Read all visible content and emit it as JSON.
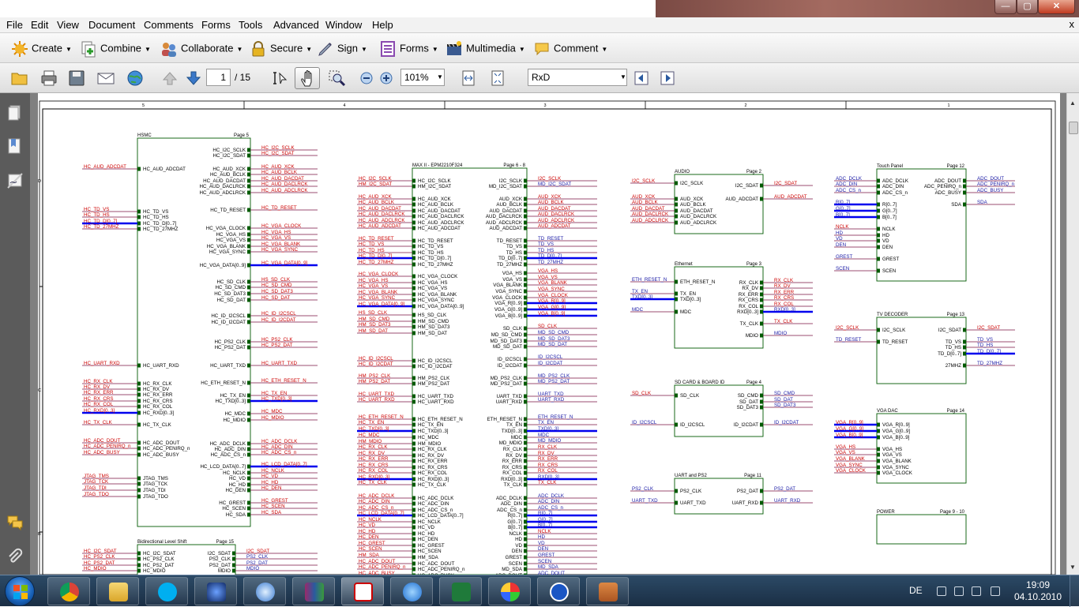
{
  "menu": {
    "items": [
      "File",
      "Edit",
      "View",
      "Document",
      "Comments",
      "Forms",
      "Tools",
      "Advanced",
      "Window",
      "Help"
    ],
    "close_glyph": "x"
  },
  "toolbar": {
    "tasks": [
      {
        "label": "Create",
        "icon": "create-icon"
      },
      {
        "label": "Combine",
        "icon": "combine-icon"
      },
      {
        "label": "Collaborate",
        "icon": "collaborate-icon"
      },
      {
        "label": "Secure",
        "icon": "lock-icon"
      },
      {
        "label": "Sign",
        "icon": "pen-icon"
      },
      {
        "label": "Forms",
        "icon": "forms-icon"
      },
      {
        "label": "Multimedia",
        "icon": "multimedia-icon"
      },
      {
        "label": "Comment",
        "icon": "comment-icon"
      }
    ]
  },
  "nav": {
    "page_current": "1",
    "page_total": "/ 15",
    "zoom": "101%",
    "find": "RxD"
  },
  "schematic": {
    "grid_top": [
      "5",
      "4",
      "3",
      "2",
      "1"
    ],
    "grid_left": [
      "D",
      "C",
      "B"
    ],
    "blocks": [
      {
        "id": "hsmc",
        "title": "HSMC",
        "page": "Page 5",
        "left_pins": [
          "HC_AUD_ADCDAT",
          "HC_TD_VS",
          "HC_TD_HS",
          "HC_TD_D[0..7]",
          "HC_TD_27MHZ",
          "HC_UART_RXD",
          "HC_RX_CLK",
          "HC_RX_DV",
          "HC_RX_ERR",
          "HC_RX_CRS",
          "HC_RX_COL",
          "HC_RXD[0..3]",
          "HC_TX_CLK",
          "HC_ADC_DOUT",
          "HC_ADC_PENIRQ_n",
          "HC_ADC_BUSY",
          "JTAG_TMS",
          "JTAG_TCK",
          "JTAG_TDI",
          "JTAG_TDO"
        ],
        "left_nets": [
          "HC_AUD_ADCDAT",
          "HC_TD_VS",
          "HC_TD_HS",
          "HC_TD_D[0..7]",
          "HC_TD_27MHZ",
          "HC_UART_RXD",
          "HC_RX_CLK",
          "HC_RX_DV",
          "HC_RX_ERR",
          "HC_RX_CRS",
          "HC_RX_COL",
          "HC_RXD[0..3]",
          "HC_TX_CLK",
          "HC_ADC_DOUT",
          "HC_ADC_PENIRQ_n",
          "HC_ADC_BUSY",
          "JTAG_TMS",
          "JTAG_TCK",
          "JTAG_TDI",
          "JTAG_TDO"
        ],
        "right_pins": [
          "HC_I2C_SCLK",
          "HC_I2C_SDAT",
          "HC_AUD_XCK",
          "HC_AUD_BCLK",
          "HC_AUD_DACDAT",
          "HC_AUD_DACLRCK",
          "HC_AUD_ADCLRCK",
          "HC_TD_RESET",
          "HC_VGA_CLOCK",
          "HC_VGA_HS",
          "HC_VGA_VS",
          "HC_VGA_BLANK",
          "HC_VGA_SYNC",
          "HC_VGA_DATA[0..9]",
          "HC_SD_CLK",
          "HC_SD_CMD",
          "HC_SD_DAT3",
          "HC_SD_DAT",
          "HC_ID_I2CSCL",
          "HC_ID_I2CDAT",
          "HC_PS2_CLK",
          "HC_PS2_DAT",
          "HC_UART_TXD",
          "HC_ETH_RESET_N",
          "HC_TX_EN",
          "HC_TXD[0..3]",
          "HC_MDC",
          "HC_MDIO",
          "HC_ADC_DCLK",
          "HC_ADC_DIN",
          "HC_ADC_CS_n",
          "HC_LCD_DATA[0..7]",
          "HC_NCLK",
          "HC_VD",
          "HC_HD",
          "HC_DEN",
          "HC_GREST",
          "HC_SCEN",
          "HC_SDA"
        ],
        "right_nets": [
          "HC_I2C_SCLK",
          "HC_I2C_SDAT",
          "HC_AUD_XCK",
          "HC_AUD_BCLK",
          "HC_AUD_DACDAT",
          "HC_AUD_DACLRCK",
          "HC_AUD_ADCLRCK",
          "HC_TD_RESET",
          "HC_VGA_CLOCK",
          "HC_VGA_HS",
          "HC_VGA_VS",
          "HC_VGA_BLANK",
          "HC_VGA_SYNC",
          "HC_VGA_DATA[0..9]",
          "HS_SD_CLK",
          "HC_SD_CMD",
          "HC_SD_DAT3",
          "HC_SD_DAT",
          "HC_ID_I2CSCL",
          "HC_ID_I2CDAT",
          "HC_PS2_CLK",
          "HC_PS2_DAT",
          "HC_UART_TXD",
          "HC_ETH_RESET_N",
          "HC_TX_EN",
          "HC_TXD[0..3]",
          "HC_MDC",
          "HC_MDIO",
          "HC_ADC_DCLK",
          "HC_ADC_DIN",
          "HC_ADC_CS_n",
          "HC_LCD_DATA[0..7]",
          "HC_NCLK",
          "HC_VD",
          "HC_HD",
          "HC_DEN",
          "HC_GREST",
          "HC_SCEN",
          "HC_SDA"
        ]
      },
      {
        "id": "maxii",
        "title": "MAX II - EPM2210F324",
        "page": "Page 6 - 8",
        "left_pins": [
          "HC_I2C_SCLK",
          "HM_I2C_SDAT",
          "HC_AUD_XCK",
          "HC_AUD_BCLK",
          "HC_AUD_DACDAT",
          "HC_AUD_DACLRCK",
          "HC_AUD_ADCLRCK",
          "HC_AUD_ADCDAT",
          "HC_TD_RESET",
          "HC_TD_VS",
          "HC_TD_HS",
          "HC_TD_D[0..7]",
          "HC_TD_27MHZ",
          "HC_VGA_CLOCK",
          "HC_VGA_HS",
          "HC_VGA_VS",
          "HC_VGA_BLANK",
          "HC_VGA_SYNC",
          "HC_VGA_DATA[0..9]",
          "HS_SD_CLK",
          "HM_SD_CMD",
          "HM_SD_DAT3",
          "HM_SD_DAT",
          "HC_ID_I2CSCL",
          "HC_ID_I2CDAT",
          "HM_PS2_CLK",
          "HM_PS2_DAT",
          "HC_UART_TXD",
          "HC_UART_RXD",
          "HC_ETH_RESET_N",
          "HC_TX_EN",
          "HC_TXD[0..3]",
          "HC_MDC",
          "HM_MDIO",
          "HC_RX_CLK",
          "HC_RX_DV",
          "HC_RX_ERR",
          "HC_RX_CRS",
          "HC_RX_COL",
          "HC_RXD[0..3]",
          "HC_TX_CLK",
          "HC_ADC_DCLK",
          "HC_ADC_DIN",
          "HC_ADC_CS_n",
          "HC_LCD_DATA[0..7]",
          "HC_NCLK",
          "HC_VD",
          "HC_HD",
          "HC_DEN",
          "HC_GREST",
          "HC_SCEN",
          "HM_SDA",
          "HC_ADC_DOUT",
          "HC_ADC_PENIRQ_n",
          "HC_ADC_BUSY"
        ],
        "left_nets": [
          "HC_I2C_SCLK",
          "HM_I2C_SDAT",
          "HC_AUD_XCK",
          "HC_AUD_BCLK",
          "HC_AUD_DACDAT",
          "HC_AUD_DACLRCK",
          "HC_AUD_ADCLRCK",
          "HC_AUD_ADCDAT",
          "HC_TD_RESET",
          "HC_TD_VS",
          "HC_TD_HS",
          "HC_TD_D[0..7]",
          "HC_TD_27MHZ",
          "HC_VGA_CLOCK",
          "HC_VGA_HS",
          "HC_VGA_VS",
          "HC_VGA_BLANK",
          "HC_VGA_SYNC",
          "HC_VGA_DATA[0..9]",
          "HS_SD_CLK",
          "HM_SD_CMD",
          "HM_SD_DAT3",
          "HM_SD_DAT",
          "HC_ID_I2CSCL",
          "HC_ID_I2CDAT",
          "HM_PS2_CLK",
          "HM_PS2_DAT",
          "HC_UART_TXD",
          "HC_UART_RXD",
          "HC_ETH_RESET_N",
          "HC_TX_EN",
          "HC_TXD[0..3]",
          "HC_MDC",
          "HM_MDIO",
          "HC_RX_CLK",
          "HC_RX_DV",
          "HC_RX_ERR",
          "HC_RX_CRS",
          "HC_RX_COL",
          "HC_RXD[0..3]",
          "HC_TX_CLK",
          "HC_ADC_DCLK",
          "HC_ADC_DIN",
          "HC_ADC_CS_n",
          "HC_LCD_DATA[0..7]",
          "HC_NCLK",
          "HC_VD",
          "HC_HD",
          "HC_DEN",
          "HC_GREST",
          "HC_SCEN",
          "HM_SDA",
          "HC_ADC_DOUT",
          "HC_ADC_PENIRQ_n",
          "HC_ADC_BUSY"
        ],
        "right_pins": [
          "I2C_SCLK",
          "MD_I2C_SDAT",
          "AUD_XCK",
          "AUD_BCLK",
          "AUD_DACDAT",
          "AUD_DACLRCK",
          "AUD_ADCLRCK",
          "AUD_ADCDAT",
          "TD_RESET",
          "TD_VS",
          "TD_HS",
          "TD_D[0..7]",
          "TD_27MHZ",
          "VGA_HS",
          "VGA_VS",
          "VGA_BLANK",
          "VGA_SYNC",
          "VGA_CLOCK",
          "VGA_R[0..9]",
          "VGA_G[0..9]",
          "VGA_B[0..9]",
          "SD_CLK",
          "MD_SD_CMD",
          "MD_SD_DAT3",
          "MD_SD_DAT",
          "ID_I2CSCL",
          "ID_I2CDAT",
          "MD_PS2_CLK",
          "MD_PS2_DAT",
          "UART_TXD",
          "UART_RXD",
          "ETH_RESET_N",
          "TX_EN",
          "TXD[0..3]",
          "MDC",
          "MD_MDIO",
          "RX_CLK",
          "RX_DV",
          "RX_ERR",
          "RX_CRS",
          "RX_COL",
          "RXD[0..3]",
          "TX_CLK",
          "ADC_DCLK",
          "ADC_DIN",
          "ADC_CS_n",
          "R[0..7]",
          "G[0..7]",
          "B[0..7]",
          "NCLK",
          "HD",
          "VD",
          "DEN",
          "GREST",
          "SCEN",
          "MD_SDA",
          "ADC_DOUT"
        ],
        "right_nets": [
          "I2C_SCLK",
          "MD_I2C_SDAT",
          "AUD_XCK",
          "AUD_BCLK",
          "AUD_DACDAT",
          "AUD_DACLRCK",
          "AUD_ADCLRCK",
          "AUD_ADCDAT",
          "TD_RESET",
          "TD_VS",
          "TD_HS",
          "TD_D[0..7]",
          "TD_27MHZ",
          "VGA_HS",
          "VGA_VS",
          "VGA_BLANK",
          "VGA_SYNC",
          "VGA_CLOCK",
          "VGA_R[0..9]",
          "VGA_G[0..9]",
          "VGA_B[0..9]",
          "SD_CLK",
          "MD_SD_CMD",
          "MD_SD_DAT3",
          "MD_SD_DAT",
          "ID_I2CSCL",
          "ID_I2CDAT",
          "MD_PS2_CLK",
          "MD_PS2_DAT",
          "UART_TXD",
          "UART_RXD",
          "ETH_RESET_N",
          "TX_EN",
          "TXD[0..3]",
          "MDC",
          "MD_MDIO",
          "RX_CLK",
          "RX_DV",
          "RX_ERR",
          "RX_CRS",
          "RX_COL",
          "RXD[0..3]",
          "TX_CLK",
          "ADC_DCLK",
          "ADC_DIN",
          "ADC_CS_n",
          "R[0..7]",
          "G[0..7]",
          "B[0..7]",
          "NCLK",
          "HD",
          "VD",
          "DEN",
          "GREST",
          "SCEN",
          "MD_SDA",
          "ADC_DOUT"
        ]
      },
      {
        "id": "audio",
        "title": "AUDIO",
        "page": "Page 2",
        "left_pins": [
          "I2C_SCLK",
          "AUD_XCK",
          "AUD_BCLK",
          "AUD_DACDAT",
          "AUD_DACLRCK",
          "AUD_ADCLRCK"
        ],
        "left_nets": [
          "I2C_SCLK",
          "AUD_XCK",
          "AUD_BCLK",
          "AUD_DACDAT",
          "AUD_DACLRCK",
          "AUD_ADCLRCK"
        ],
        "right_pins": [
          "I2C_SDAT",
          "AUD_ADCDAT"
        ],
        "right_nets": [
          "I2C_SDAT",
          "AUD_ADCDAT"
        ]
      },
      {
        "id": "ethernet",
        "title": "Ethernet",
        "page": "Page 3",
        "left_pins": [
          "ETH_RESET_N",
          "TX_EN",
          "TXD[0..3]",
          "MDC"
        ],
        "left_nets": [
          "ETH_RESET_N",
          "TX_EN",
          "TXD[0..3]",
          "MDC"
        ],
        "right_pins": [
          "RX_CLK",
          "RX_DV",
          "RX_ERR",
          "RX_CRS",
          "RX_COL",
          "RXD[0..3]",
          "TX_CLK",
          "MDIO"
        ],
        "right_nets": [
          "RX_CLK",
          "RX_DV",
          "RX_ERR",
          "RX_CRS",
          "RX_COL",
          "RXD[0..3]",
          "TX_CLK",
          "MDIO"
        ]
      },
      {
        "id": "sdcard",
        "title": "SD CARD & BOARD ID",
        "page": "Page 4",
        "left_pins": [
          "SD_CLK",
          "ID_I2CSCL"
        ],
        "left_nets": [
          "SD_CLK",
          "ID_I2CSCL"
        ],
        "right_pins": [
          "SD_CMD",
          "SD_DAT",
          "SD_DAT3",
          "ID_I2CDAT"
        ],
        "right_nets": [
          "SD_CMD",
          "SD_DAT",
          "SD_DAT3",
          "ID_I2CDAT"
        ]
      },
      {
        "id": "uartps2",
        "title": "UART and PS2",
        "page": "Page 11",
        "left_pins": [
          "PS2_CLK",
          "UART_TXD"
        ],
        "left_nets": [
          "PS2_CLK",
          "UART_TXD"
        ],
        "right_pins": [
          "PS2_DAT",
          "UART_RXD"
        ],
        "right_nets": [
          "PS2_DAT",
          "UART_RXD"
        ]
      },
      {
        "id": "touch",
        "title": "Touch Panel",
        "page": "Page 12",
        "left_pins": [
          "ADC_DCLK",
          "ADC_DIN",
          "ADC_CS_n",
          "R[0..7]",
          "G[0..7]",
          "B[0..7]",
          "NCLK",
          "HD",
          "VD",
          "DEN",
          "GREST",
          "SCEN"
        ],
        "left_nets": [
          "ADC_DCLK",
          "ADC_DIN",
          "ADC_CS_n",
          "R[0..7]",
          "G[0..7]",
          "B[0..7]",
          "NCLK",
          "HD",
          "VD",
          "DEN",
          "GREST",
          "SCEN"
        ],
        "right_pins": [
          "ADC_DOUT",
          "ADC_PENIRQ_n",
          "ADC_BUSY",
          "SDA"
        ],
        "right_nets": [
          "ADC_DOUT",
          "ADC_PENIRQ_n",
          "ADC_BUSY",
          "SDA"
        ]
      },
      {
        "id": "tvdecoder",
        "title": "TV DECODER",
        "page": "Page 13",
        "left_pins": [
          "I2C_SCLK",
          "TD_RESET"
        ],
        "left_nets": [
          "I2C_SCLK",
          "TD_RESET"
        ],
        "right_pins": [
          "I2C_SDAT",
          "TD_VS",
          "TD_HS",
          "TD_D[0..7]",
          "27MHZ"
        ],
        "right_nets": [
          "I2C_SDAT",
          "TD_VS",
          "TD_HS",
          "TD_D[0..7]",
          "TD_27MHZ"
        ]
      },
      {
        "id": "vgadac",
        "title": "VGA DAC",
        "page": "Page 14",
        "left_pins": [
          "VGA_R[0..9]",
          "VGA_G[0..9]",
          "VGA_B[0..9]",
          "VGA_HS",
          "VGA_VS",
          "VGA_BLANK",
          "VGA_SYNC",
          "VGA_CLOCK"
        ],
        "left_nets": [
          "VGA_R[0..9]",
          "VGA_G[0..9]",
          "VGA_B[0..9]",
          "VGA_HS",
          "VGA_VS",
          "VGA_BLANK",
          "VGA_SYNC",
          "VGA_CLOCK"
        ],
        "right_pins": [],
        "right_nets": []
      },
      {
        "id": "power",
        "title": "POWER",
        "page": "Page 9 - 10",
        "left_pins": [],
        "left_nets": [],
        "right_pins": [],
        "right_nets": []
      },
      {
        "id": "bidir",
        "title": "Bidirectional Level Shift",
        "page": "Page 15",
        "left_pins": [
          "HC_I2C_SDAT",
          "HC_PS2_CLK",
          "HC_PS2_DAT",
          "HC_MDIO"
        ],
        "left_nets": [
          "HC_I2C_SDAT",
          "HC_PS2_CLK",
          "HC_PS2_DAT",
          "HC_MDIO"
        ],
        "right_pins": [
          "I2C_SDAT",
          "PS2_CLK",
          "PS2_DAT",
          "MDIO"
        ],
        "right_nets": [
          "I2C_SDAT",
          "PS2_CLK",
          "PS2_DAT",
          "MDIO"
        ]
      }
    ]
  },
  "taskbar": {
    "language": "DE",
    "time": "19:09",
    "date": "04.10.2010",
    "apps": [
      "chrome-icon",
      "explorer-icon",
      "skype-icon",
      "photo-viewer-icon",
      "itunes-icon",
      "winrar-icon",
      "acrobat-icon",
      "internet-explorer-icon",
      "excel-icon",
      "paint-icon",
      "teamviewer-icon",
      "app-icon"
    ]
  },
  "colors": {
    "net_red": "#cc0000",
    "net_blue": "#1a1aa6",
    "bus_blue": "#0000ee",
    "wire": "#7a1040",
    "box": "#005a00"
  }
}
